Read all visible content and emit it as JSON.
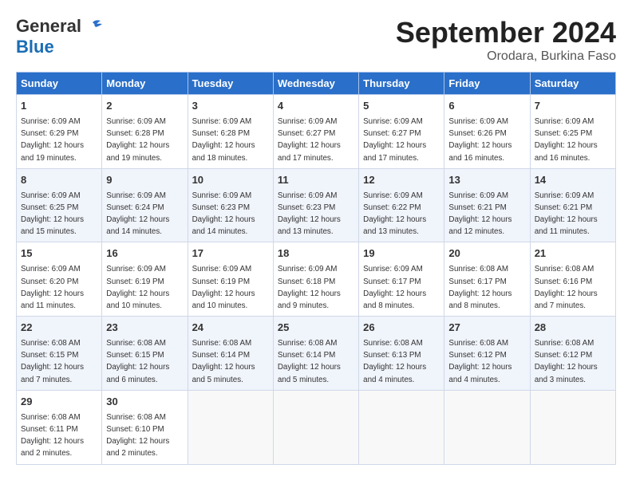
{
  "header": {
    "logo_general": "General",
    "logo_blue": "Blue",
    "month_title": "September 2024",
    "subtitle": "Orodara, Burkina Faso"
  },
  "weekdays": [
    "Sunday",
    "Monday",
    "Tuesday",
    "Wednesday",
    "Thursday",
    "Friday",
    "Saturday"
  ],
  "weeks": [
    [
      {
        "day": "1",
        "sunrise": "6:09 AM",
        "sunset": "6:29 PM",
        "daylight": "12 hours and 19 minutes."
      },
      {
        "day": "2",
        "sunrise": "6:09 AM",
        "sunset": "6:28 PM",
        "daylight": "12 hours and 19 minutes."
      },
      {
        "day": "3",
        "sunrise": "6:09 AM",
        "sunset": "6:28 PM",
        "daylight": "12 hours and 18 minutes."
      },
      {
        "day": "4",
        "sunrise": "6:09 AM",
        "sunset": "6:27 PM",
        "daylight": "12 hours and 17 minutes."
      },
      {
        "day": "5",
        "sunrise": "6:09 AM",
        "sunset": "6:27 PM",
        "daylight": "12 hours and 17 minutes."
      },
      {
        "day": "6",
        "sunrise": "6:09 AM",
        "sunset": "6:26 PM",
        "daylight": "12 hours and 16 minutes."
      },
      {
        "day": "7",
        "sunrise": "6:09 AM",
        "sunset": "6:25 PM",
        "daylight": "12 hours and 16 minutes."
      }
    ],
    [
      {
        "day": "8",
        "sunrise": "6:09 AM",
        "sunset": "6:25 PM",
        "daylight": "12 hours and 15 minutes."
      },
      {
        "day": "9",
        "sunrise": "6:09 AM",
        "sunset": "6:24 PM",
        "daylight": "12 hours and 14 minutes."
      },
      {
        "day": "10",
        "sunrise": "6:09 AM",
        "sunset": "6:23 PM",
        "daylight": "12 hours and 14 minutes."
      },
      {
        "day": "11",
        "sunrise": "6:09 AM",
        "sunset": "6:23 PM",
        "daylight": "12 hours and 13 minutes."
      },
      {
        "day": "12",
        "sunrise": "6:09 AM",
        "sunset": "6:22 PM",
        "daylight": "12 hours and 13 minutes."
      },
      {
        "day": "13",
        "sunrise": "6:09 AM",
        "sunset": "6:21 PM",
        "daylight": "12 hours and 12 minutes."
      },
      {
        "day": "14",
        "sunrise": "6:09 AM",
        "sunset": "6:21 PM",
        "daylight": "12 hours and 11 minutes."
      }
    ],
    [
      {
        "day": "15",
        "sunrise": "6:09 AM",
        "sunset": "6:20 PM",
        "daylight": "12 hours and 11 minutes."
      },
      {
        "day": "16",
        "sunrise": "6:09 AM",
        "sunset": "6:19 PM",
        "daylight": "12 hours and 10 minutes."
      },
      {
        "day": "17",
        "sunrise": "6:09 AM",
        "sunset": "6:19 PM",
        "daylight": "12 hours and 10 minutes."
      },
      {
        "day": "18",
        "sunrise": "6:09 AM",
        "sunset": "6:18 PM",
        "daylight": "12 hours and 9 minutes."
      },
      {
        "day": "19",
        "sunrise": "6:09 AM",
        "sunset": "6:17 PM",
        "daylight": "12 hours and 8 minutes."
      },
      {
        "day": "20",
        "sunrise": "6:08 AM",
        "sunset": "6:17 PM",
        "daylight": "12 hours and 8 minutes."
      },
      {
        "day": "21",
        "sunrise": "6:08 AM",
        "sunset": "6:16 PM",
        "daylight": "12 hours and 7 minutes."
      }
    ],
    [
      {
        "day": "22",
        "sunrise": "6:08 AM",
        "sunset": "6:15 PM",
        "daylight": "12 hours and 7 minutes."
      },
      {
        "day": "23",
        "sunrise": "6:08 AM",
        "sunset": "6:15 PM",
        "daylight": "12 hours and 6 minutes."
      },
      {
        "day": "24",
        "sunrise": "6:08 AM",
        "sunset": "6:14 PM",
        "daylight": "12 hours and 5 minutes."
      },
      {
        "day": "25",
        "sunrise": "6:08 AM",
        "sunset": "6:14 PM",
        "daylight": "12 hours and 5 minutes."
      },
      {
        "day": "26",
        "sunrise": "6:08 AM",
        "sunset": "6:13 PM",
        "daylight": "12 hours and 4 minutes."
      },
      {
        "day": "27",
        "sunrise": "6:08 AM",
        "sunset": "6:12 PM",
        "daylight": "12 hours and 4 minutes."
      },
      {
        "day": "28",
        "sunrise": "6:08 AM",
        "sunset": "6:12 PM",
        "daylight": "12 hours and 3 minutes."
      }
    ],
    [
      {
        "day": "29",
        "sunrise": "6:08 AM",
        "sunset": "6:11 PM",
        "daylight": "12 hours and 2 minutes."
      },
      {
        "day": "30",
        "sunrise": "6:08 AM",
        "sunset": "6:10 PM",
        "daylight": "12 hours and 2 minutes."
      },
      null,
      null,
      null,
      null,
      null
    ]
  ]
}
